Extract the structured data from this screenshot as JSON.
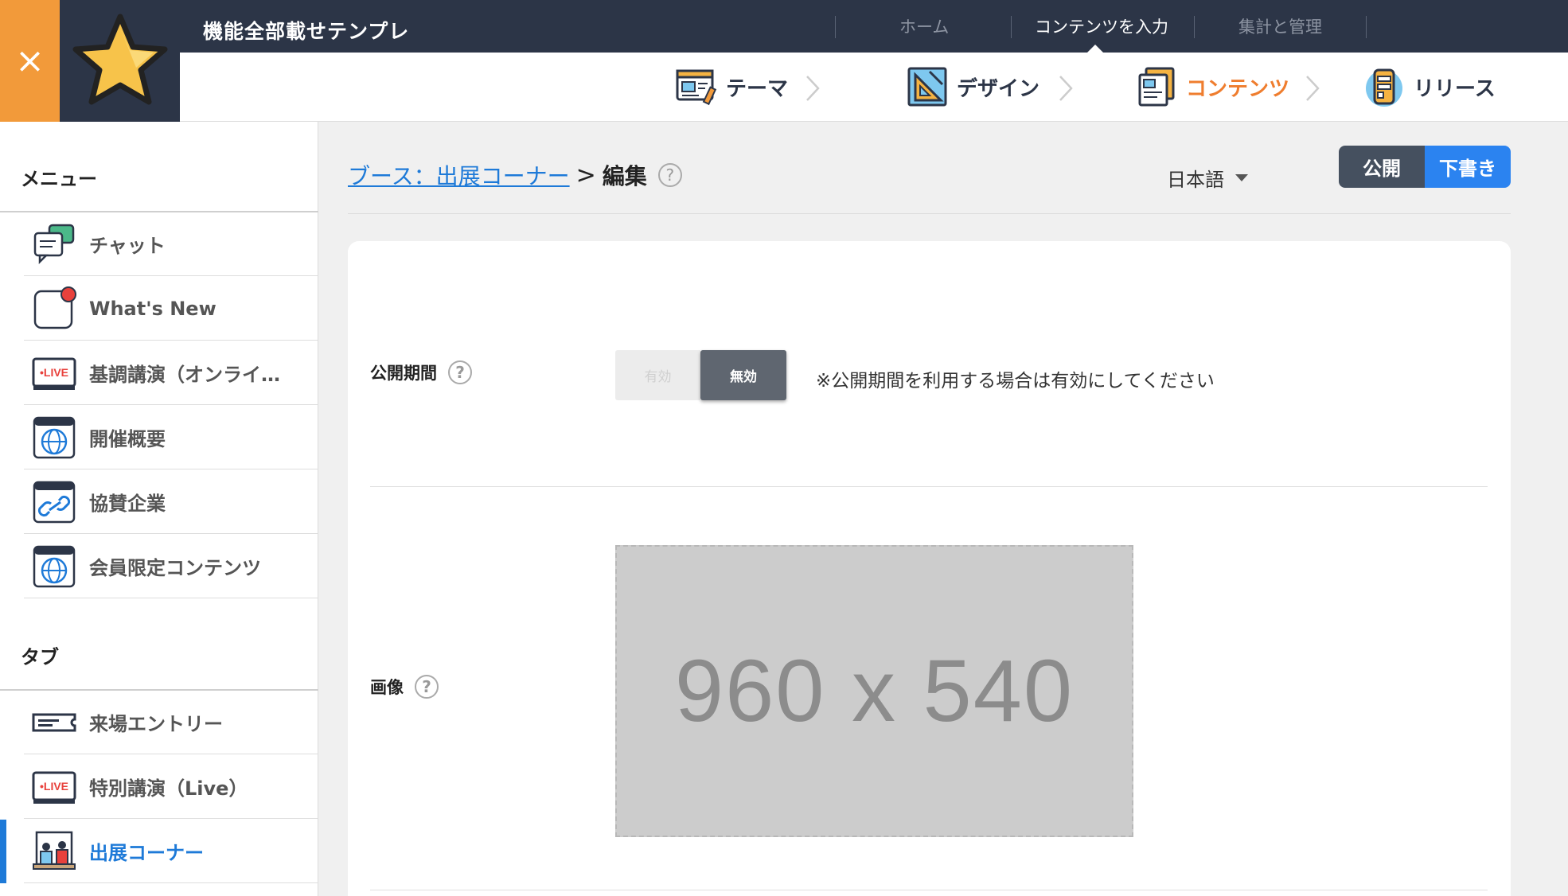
{
  "header": {
    "close_label": "×",
    "app_title": "機能全部載せテンプレ",
    "top_nav": [
      "ホーム",
      "コンテンツを入力",
      "集計と管理"
    ],
    "steps": [
      {
        "label": "テーマ",
        "icon": "theme-icon"
      },
      {
        "label": "デザイン",
        "icon": "design-icon"
      },
      {
        "label": "コンテンツ",
        "icon": "content-icon"
      },
      {
        "label": "リリース",
        "icon": "release-icon"
      }
    ],
    "active_step": "コンテンツ",
    "colors": {
      "dark": "#2c3547",
      "accent": "#ef7d2e",
      "close": "#f29a3a"
    }
  },
  "sidebar": {
    "menu_heading": "メニュー",
    "menu_items": [
      {
        "label": "チャット",
        "icon": "chat-icon"
      },
      {
        "label": "What's New",
        "icon": "notification-icon"
      },
      {
        "label": "基調講演（オンライ…",
        "icon": "live-icon"
      },
      {
        "label": "開催概要",
        "icon": "globe-icon"
      },
      {
        "label": "協賛企業",
        "icon": "link-icon"
      },
      {
        "label": "会員限定コンテンツ",
        "icon": "globe-icon"
      }
    ],
    "tab_heading": "タブ",
    "tab_items": [
      {
        "label": "来場エントリー",
        "icon": "ticket-icon"
      },
      {
        "label": "特別講演（Live）",
        "icon": "live-icon"
      },
      {
        "label": "出展コーナー",
        "icon": "booth-icon",
        "active": true
      }
    ]
  },
  "main": {
    "breadcrumb_link": "ブース：出展コーナー ",
    "breadcrumb_sep": ">",
    "breadcrumb_current": "編集",
    "language": "日本語",
    "status_publish": "公開",
    "status_draft": "下書き",
    "period_label": "公開期間",
    "period_on": "有効",
    "period_off": "無効",
    "period_note": "※公開期間を利用する場合は有効にしてください",
    "image_label": "画像",
    "image_placeholder": "960 x 540"
  }
}
